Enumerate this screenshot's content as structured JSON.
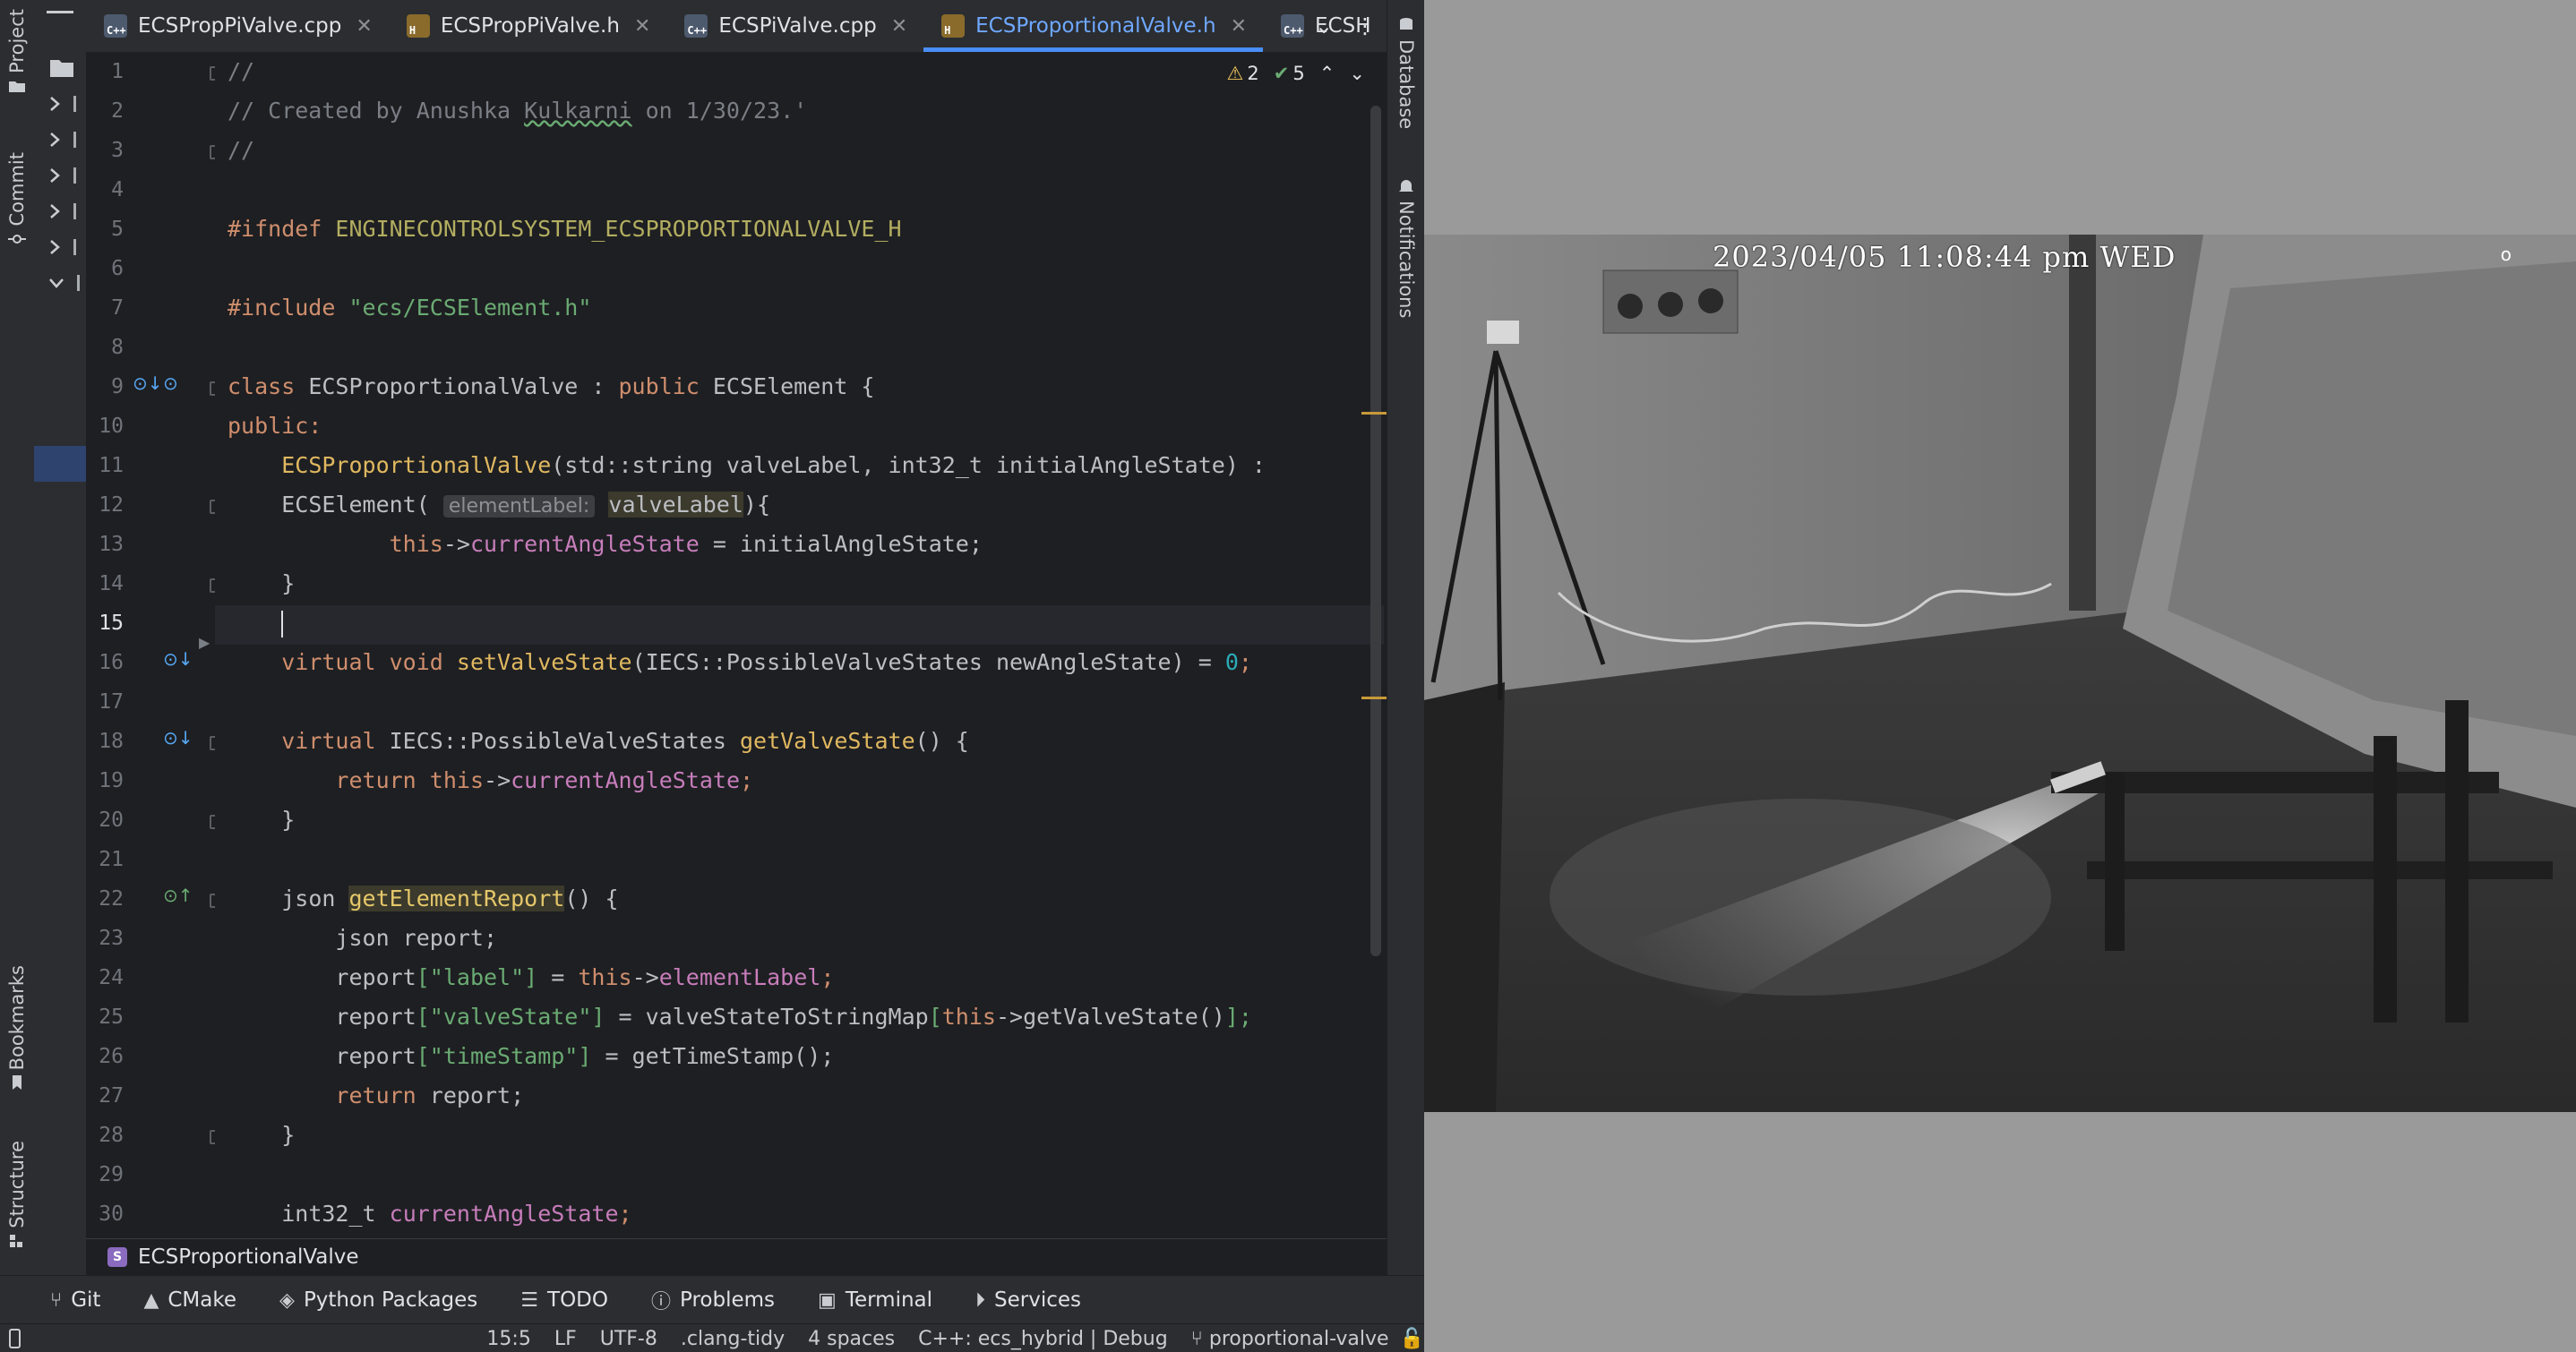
{
  "left_strip": {
    "project": "Project",
    "commit": "Commit",
    "bookmarks": "Bookmarks",
    "structure": "Structure"
  },
  "right_strip": {
    "database": "Database",
    "notifications": "Notifications"
  },
  "tabs": [
    {
      "label": "ECSPropPiValve.cpp",
      "type": "cpp"
    },
    {
      "label": "ECSPropPiValve.h",
      "type": "h"
    },
    {
      "label": "ECSPiValve.cpp",
      "type": "cpp"
    },
    {
      "label": "ECSProportionalValve.h",
      "type": "h",
      "active": true
    },
    {
      "label": "ECSH",
      "type": "cpp"
    }
  ],
  "inspections": {
    "warnings": "2",
    "ok": "5"
  },
  "editor": {
    "current_line": 15,
    "lines": [
      "1",
      "2",
      "3",
      "4",
      "5",
      "6",
      "7",
      "8",
      "9",
      "10",
      "11",
      "12",
      "13",
      "14",
      "15",
      "16",
      "17",
      "18",
      "19",
      "20",
      "21",
      "22",
      "23",
      "24",
      "25",
      "26",
      "27",
      "28",
      "29",
      "30"
    ],
    "comment_1": "//",
    "comment_2a": "// Created by Anushka ",
    "comment_2b": "Kulkarni",
    "comment_2c": " on 1/30/23.'",
    "comment_3": "//",
    "ifndef_kw": "#ifndef",
    "ifndef_guard": " ENGINECONTROLSYSTEM_ECSPROPORTIONALVALVE_H",
    "include_kw": "#include",
    "include_path": " \"ecs/ECSElement.h\"",
    "class_kw": "class",
    "class_name": " ECSProportionalValve : ",
    "public_kw": "public",
    "base_name": " ECSElement {",
    "public_label": "public:",
    "ctor_name": "ECSProportionalValve",
    "ctor_params": "(std::string valveLabel, int32_t initialAngleState) :",
    "init_base": "ECSElement( ",
    "hint_label": "elementLabel:",
    "init_arg": "valveLabel",
    "init_end": "){",
    "this_kw": "this",
    "arrow": "->",
    "field_current": "currentAngleState",
    "assign_rest": " = initialAngleState;",
    "close_brace": "}",
    "virtual_kw": "virtual",
    "void_kw": " void ",
    "set_fn": "setValveState",
    "set_params": "(IECS::PossibleValveStates newAngleState) = ",
    "zero": "0",
    "semi": ";",
    "ret_type": " IECS::PossibleValveStates ",
    "get_fn": "getValveState",
    "get_tail": "() {",
    "return_kw": "return",
    "json_type": "json ",
    "report_fn": "getElementReport",
    "report_tail": "() {",
    "json_decl": "json report;",
    "report_var": "report",
    "key_label": "[\"label\"]",
    "key_state": "[\"valveState\"]",
    "key_time": "[\"timeStamp\"]",
    "eq": " = ",
    "field_label": "elementLabel",
    "map_call": "valveStateToStringMap",
    "get_call": "getValveState()",
    "bracket_close": "];",
    "ts_call": "getTimeStamp();",
    "ret_report": " report;",
    "int_type": "int32_t "
  },
  "breadcrumb": "ECSProportionalValve",
  "tool_windows": [
    "Git",
    "CMake",
    "Python Packages",
    "TODO",
    "Problems",
    "Terminal",
    "Services"
  ],
  "status": {
    "position": "15:5",
    "line_sep": "LF",
    "encoding": "UTF-8",
    "linter": ".clang-tidy",
    "indent": "4 spaces",
    "context": "C++: ecs_hybrid | Debug",
    "branch": "proportional-valve"
  },
  "camera": {
    "timestamp": "2023/04/05 11:08:44 pm WED",
    "corner_mark": "o"
  }
}
